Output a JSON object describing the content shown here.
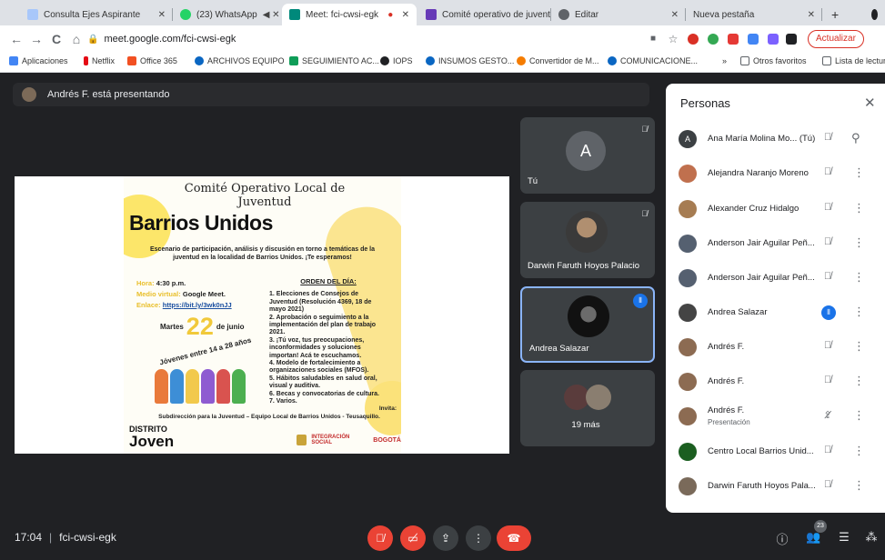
{
  "browser": {
    "tabs": [
      {
        "title": "Consulta Ejes Aspirante",
        "color": "#a8c7fa"
      },
      {
        "title": "(23) WhatsApp",
        "color": "#25d366"
      },
      {
        "title": "Meet: fci-cwsi-egk",
        "color": "#00897b"
      },
      {
        "title": "Comité operativo de juvent",
        "color": "#673ab7"
      },
      {
        "title": "Editar",
        "color": "#5f6368"
      },
      {
        "title": "Nueva pestaña",
        "color": "#ffffff"
      }
    ],
    "url": "meet.google.com/fci-cwsi-egk",
    "update_label": "Actualizar",
    "bookmarks": [
      "Aplicaciones",
      "Netflix",
      "Office 365",
      "ARCHIVOS EQUIPO",
      "SEGUIMIENTO AC...",
      "IOPS",
      "INSUMOS GESTO...",
      "Convertidor de M...",
      "COMUNICACIONE...",
      "Otros favoritos",
      "Lista de lectura"
    ],
    "bookmarks_more": "»"
  },
  "meet": {
    "presenting_text": "Andrés F. está presentando",
    "tiles": [
      {
        "name": "Tú",
        "initial": "A"
      },
      {
        "name": "Darwin Faruth Hoyos Palacio"
      },
      {
        "name": "Andrea Salazar"
      },
      {
        "name": "19 más"
      }
    ],
    "time": "17:04",
    "meeting_code": "fci-cwsi-egk",
    "people_count": "23"
  },
  "slide": {
    "title": "Comité Operativo Local de Juventud",
    "headline": "Barrios Unidos",
    "description": "Escenario de participación, análisis y discusión en torno a temáticas de la juventud en la localidad de Barrios Unidos. ¡Te esperamos!",
    "hora_label": "Hora:",
    "hora_value": "4:30 p.m.",
    "medio_label": "Medio virtual:",
    "medio_value": "Google Meet.",
    "enlace_label": "Enlace:",
    "enlace_value": "https://bit.ly/3wk0nJJ",
    "date_day_name": "Martes",
    "date_day": "22",
    "date_month": "de junio",
    "ages": "Jóvenes entre 14 a 28 años",
    "orden_title": "ORDEN DEL DÍA:",
    "orden_items": [
      "1. Elecciones de Consejos de Juventud (Resolución 4369, 18 de mayo 2021)",
      "2. Aprobación o seguimiento a la implementación del plan de trabajo 2021.",
      "3. ¡Tú voz, tus preocupaciones, inconformidades y soluciones importan! Acá te escuchamos.",
      "4. Modelo de fortalecimiento a organizaciones sociales (MFOS).",
      "5. Hábitos saludables en salud oral, visual y auditiva.",
      "6. Becas y convocatorias de cultura.",
      "7. Varios."
    ],
    "invita_label": "Invita:",
    "invita_text": "Subdirección para la Juventud – Equipo Local de Barrios Unidos - Teusaquillo.",
    "distrito_top": "DISTRITO",
    "distrito_bottom": "Joven",
    "logo_social": "INTEGRACIÓN SOCIAL",
    "logo_bogota": "BOGOTÁ"
  },
  "panel": {
    "title": "Personas",
    "people": [
      {
        "name": "Ana María Molina Mo...  (Tú)",
        "color": "#3c4043",
        "status": "muted",
        "action": "pin"
      },
      {
        "name": "Alejandra Naranjo Moreno",
        "color": "#c0704e",
        "status": "muted",
        "action": "menu"
      },
      {
        "name": "Alexander Cruz Hidalgo",
        "color": "#a67c52",
        "status": "muted",
        "action": "menu"
      },
      {
        "name": "Anderson Jair Aguilar Peñ...",
        "color": "#556070",
        "status": "muted",
        "action": "menu"
      },
      {
        "name": "Anderson Jair Aguilar Peñ...",
        "color": "#556070",
        "status": "muted",
        "action": "menu"
      },
      {
        "name": "Andrea Salazar",
        "color": "#444444",
        "status": "speaking",
        "action": "menu"
      },
      {
        "name": "Andrés F.",
        "color": "#8c6b52",
        "status": "muted",
        "action": "menu"
      },
      {
        "name": "Andrés F.",
        "color": "#8c6b52",
        "status": "muted",
        "action": "menu"
      },
      {
        "name": "Andrés F.",
        "sub": "Presentación",
        "color": "#8c6b52",
        "status": "presenting",
        "action": "menu"
      },
      {
        "name": "Centro Local Barrios Unid...",
        "color": "#1b5e20",
        "status": "muted",
        "action": "menu"
      },
      {
        "name": "Darwin Faruth Hoyos Pala...",
        "color": "#7a6a5a",
        "status": "muted",
        "action": "menu"
      }
    ]
  }
}
